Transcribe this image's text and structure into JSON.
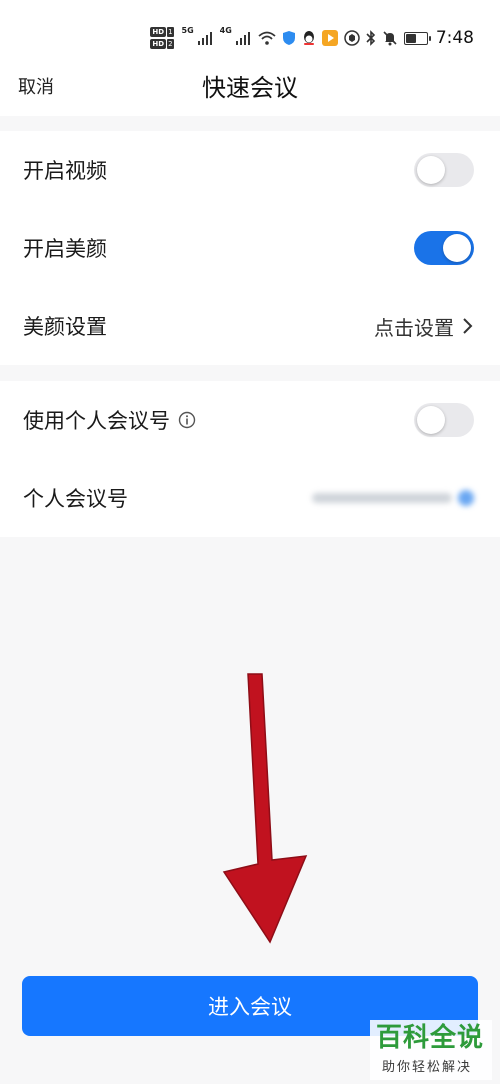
{
  "status_bar": {
    "network_gen_1": "5G",
    "network_gen_2": "4G",
    "hd_1": "HD",
    "hd_1_num": "1",
    "hd_2": "HD",
    "hd_2_num": "2",
    "time": "7:48",
    "icons": [
      "hd-icon",
      "signal-icon",
      "signal-icon",
      "wifi-icon",
      "shield-app-icon",
      "qq-icon",
      "video-app-icon",
      "assistant-app-icon",
      "bluetooth-icon",
      "mute-icon",
      "battery-icon"
    ]
  },
  "nav": {
    "cancel_label": "取消",
    "title": "快速会议"
  },
  "settings": {
    "video": {
      "label": "开启视频",
      "enabled": false
    },
    "beauty": {
      "label": "开启美颜",
      "enabled": true
    },
    "beauty_settings": {
      "label": "美颜设置",
      "value": "点击设置"
    },
    "use_personal_id": {
      "label": "使用个人会议号",
      "enabled": false
    },
    "personal_id": {
      "label": "个人会议号",
      "value": ""
    }
  },
  "enter_button": {
    "label": "进入会议"
  },
  "watermark": {
    "title": "百科全说",
    "subtitle": "助你轻松解决"
  },
  "colors": {
    "accent": "#1677ff",
    "toggle_on": "#1a73e8",
    "toggle_off": "#e9e9ec",
    "arrow": "#c1121f",
    "watermark_green": "#2e9b3b"
  }
}
